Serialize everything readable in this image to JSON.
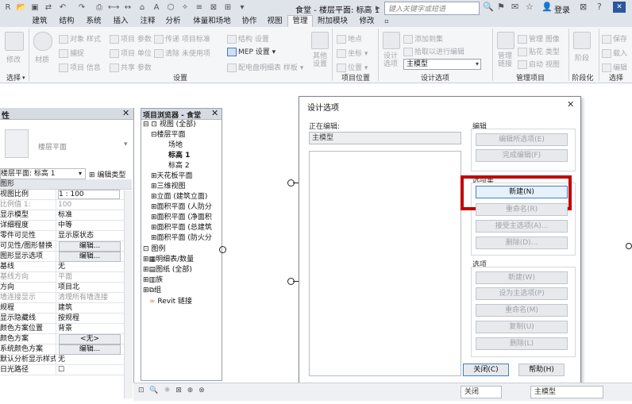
{
  "app": {
    "title": "食堂 - 楼层平面: 标高 1",
    "search_placeholder": "键入关键字或短语",
    "login": "登录",
    "close_glyph": "✕"
  },
  "tabs": [
    "建筑",
    "结构",
    "系统",
    "插入",
    "注释",
    "分析",
    "体量和场地",
    "协作",
    "视图",
    "管理",
    "附加模块",
    "修改"
  ],
  "active_tab": "管理",
  "ribbon": {
    "select": {
      "modify": "修改",
      "label": "选择"
    },
    "settings": {
      "materials": "材质",
      "items": [
        "对象 样式",
        "捕捉",
        "项目 信息",
        "项目 参数",
        "项目 单位",
        "共享 参数",
        "传递 项目标准",
        "清除 未使用项",
        "结构 设置",
        "MEP 设置",
        "配电盘明细表 样板",
        "其他 设置"
      ],
      "label": "设置"
    },
    "location": {
      "items": [
        "地点",
        "坐标",
        "位置"
      ],
      "label": "项目位置"
    },
    "design_options": {
      "big_button": "设计 选项",
      "items": [
        "添加到集",
        "拾取以进行编辑"
      ],
      "combo_value": "主模型",
      "label": "设计选项"
    },
    "manage_project": {
      "items": [
        "管理 链接",
        "管理 图像",
        "贴花 类型",
        "启动 视图"
      ],
      "label": "管理项目"
    },
    "phasing": {
      "big_button": "阶段",
      "label": "阶段化"
    },
    "selection": {
      "items": [
        "保存",
        "载入",
        "编辑"
      ],
      "label": "选择"
    }
  },
  "properties": {
    "title": "性",
    "type_name": "楼层平面",
    "selector_value": "楼层平面: 标高 1",
    "edit_type": "编辑类型",
    "group_header": "图形",
    "rows": [
      [
        "视图比例",
        "1 : 100"
      ],
      [
        "比例值 1:",
        "100"
      ],
      [
        "显示模型",
        "标准"
      ],
      [
        "详细程度",
        "中等"
      ],
      [
        "零件可见性",
        "显示原状态"
      ],
      [
        "可见性/图形替换",
        "编辑..."
      ],
      [
        "图形显示选项",
        "编辑..."
      ],
      [
        "基线",
        "无"
      ],
      [
        "基线方向",
        "平面"
      ],
      [
        "方向",
        "项目北"
      ],
      [
        "墙连接显示",
        "清理所有墙连接"
      ],
      [
        "规程",
        "建筑"
      ],
      [
        "显示隐藏线",
        "按规程"
      ],
      [
        "颜色方案位置",
        "背景"
      ],
      [
        "颜色方案",
        "<无>"
      ],
      [
        "系统颜色方案",
        "编辑..."
      ],
      [
        "默认分析显示样式",
        "无"
      ],
      [
        "日光路径",
        "☐"
      ]
    ]
  },
  "browser": {
    "title": "项目浏览器 - 食堂",
    "nodes": [
      [
        "⊟",
        "视图 (全部)"
      ],
      [
        "⊟",
        "楼层平面"
      ],
      [
        "",
        "场地"
      ],
      [
        "",
        "标高 1"
      ],
      [
        "",
        "标高 2"
      ],
      [
        "⊞",
        "天花板平面"
      ],
      [
        "⊞",
        "三维视图"
      ],
      [
        "⊞",
        "立面 (建筑立面)"
      ],
      [
        "⊞",
        "面积平面 (人防分"
      ],
      [
        "⊞",
        "面积平面 (净面积"
      ],
      [
        "⊞",
        "面积平面 (总建筑"
      ],
      [
        "⊞",
        "面积平面 (防火分"
      ],
      [
        "",
        "图例"
      ],
      [
        "⊞",
        "明细表/数量"
      ],
      [
        "⊞",
        "图纸 (全部)"
      ],
      [
        "⊞",
        "族"
      ],
      [
        "⊞",
        "组"
      ],
      [
        "",
        "Revit 链接"
      ]
    ]
  },
  "dialog": {
    "title": "设计选项",
    "close": "✕",
    "editing_label": "正在编辑:",
    "editing_value": "主模型",
    "edit_group": "编辑",
    "edit_buttons": [
      "编辑所选项(E)",
      "完成编辑(F)"
    ],
    "set_group": "选项集",
    "set_buttons": [
      "新建(N)",
      "重命名(R)",
      "接受主选项(A)...",
      "删除(D)..."
    ],
    "option_group": "选项",
    "option_buttons": [
      "新建(W)",
      "设为主选项(P)",
      "重命名(M)",
      "复制(U)",
      "删除(L)"
    ],
    "close_button": "关闭(C)",
    "help_button": "帮助(H)"
  },
  "status": {
    "left_icons": "⊡ 🔍 ☼ ⊠ ⊕ ⊗",
    "right_close": "关闭",
    "right_model": "主模型"
  },
  "colors": {
    "highlight": "#c00000",
    "title_bg": "#dfe3ea",
    "ribbon_bg": "#f5f6f8"
  }
}
